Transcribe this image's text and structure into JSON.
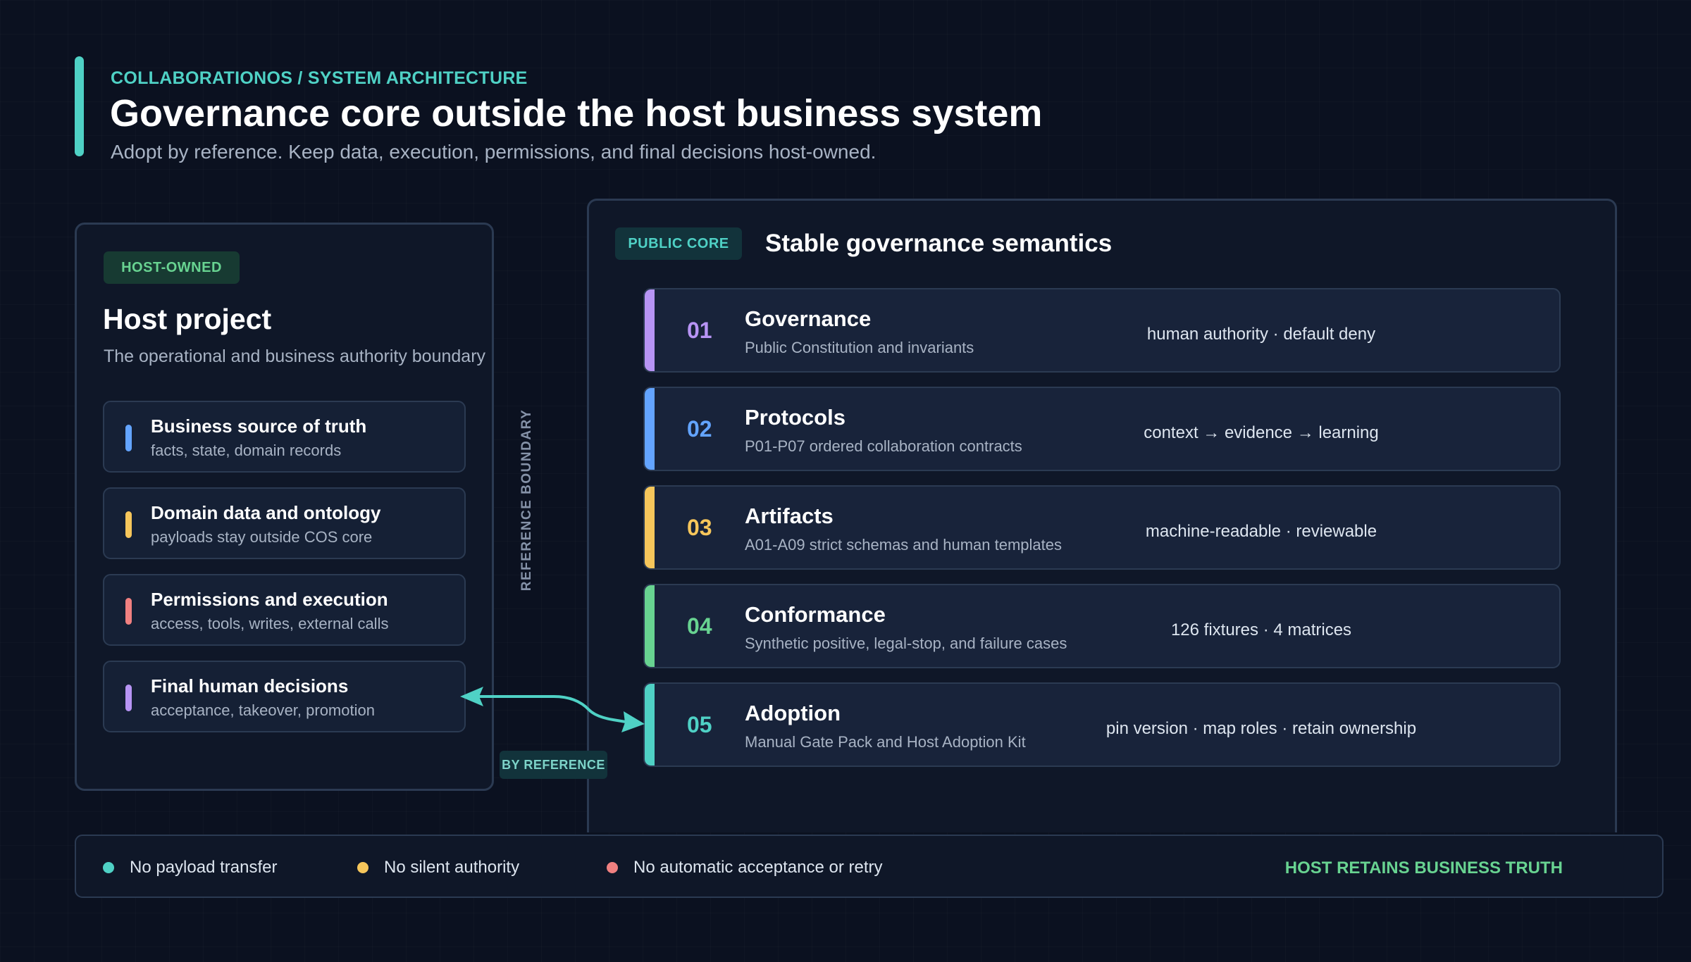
{
  "header": {
    "eyebrow": "COLLABORATIONOS / SYSTEM ARCHITECTURE",
    "title": "Governance core outside the host business system",
    "subtitle": "Adopt by reference. Keep data, execution, permissions, and final decisions host-owned."
  },
  "host": {
    "badge": "HOST-OWNED",
    "title": "Host project",
    "subtitle": "The operational and business authority boundary",
    "items": [
      {
        "title": "Business source of truth",
        "desc": "facts, state, domain records",
        "color": "#63a4ff"
      },
      {
        "title": "Domain data and ontology",
        "desc": "payloads stay outside COS core",
        "color": "#f6c65b"
      },
      {
        "title": "Permissions and execution",
        "desc": "access, tools, writes, external calls",
        "color": "#f08080"
      },
      {
        "title": "Final human decisions",
        "desc": "acceptance, takeover, promotion",
        "color": "#b794f4"
      }
    ]
  },
  "boundary": {
    "label": "REFERENCE BOUNDARY",
    "link_label": "BY REFERENCE"
  },
  "core": {
    "badge": "PUBLIC CORE",
    "title": "Stable governance semantics",
    "rows": [
      {
        "num": "01",
        "title": "Governance",
        "desc": "Public Constitution and invariants",
        "tag": "human authority · default deny",
        "color": "#b794f4"
      },
      {
        "num": "02",
        "title": "Protocols",
        "desc": "P01-P07 ordered collaboration contracts",
        "tag": "context → evidence → learning",
        "color": "#63a4ff"
      },
      {
        "num": "03",
        "title": "Artifacts",
        "desc": "A01-A09 strict schemas and human templates",
        "tag": "machine-readable · reviewable",
        "color": "#f6c65b"
      },
      {
        "num": "04",
        "title": "Conformance",
        "desc": "Synthetic positive, legal-stop, and failure cases",
        "tag": "126 fixtures · 4 matrices",
        "color": "#68d391"
      },
      {
        "num": "05",
        "title": "Adoption",
        "desc": "Manual Gate Pack and Host Adoption Kit",
        "tag": "pin version · map roles · retain ownership",
        "color": "#4fd1c5"
      }
    ]
  },
  "footer": {
    "items": [
      {
        "text": "No payload transfer",
        "color": "#4fd1c5"
      },
      {
        "text": "No silent authority",
        "color": "#f6c65b"
      },
      {
        "text": "No automatic acceptance or retry",
        "color": "#f08080"
      }
    ],
    "claim": "HOST RETAINS BUSINESS TRUTH"
  },
  "colors": {
    "background": "#0b1120",
    "accent": "#4fd1c5",
    "panel_border": "#2b3a52"
  }
}
